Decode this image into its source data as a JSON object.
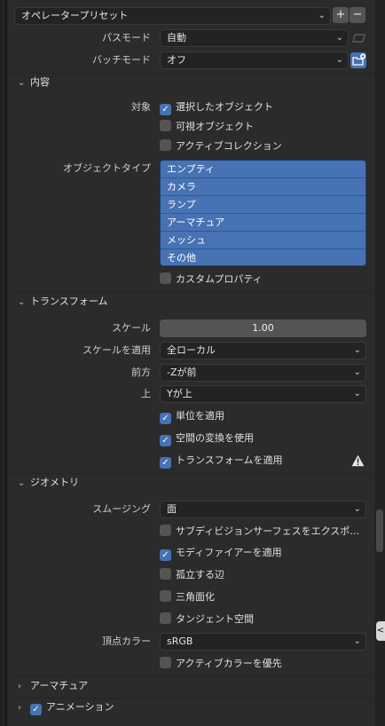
{
  "preset": {
    "label": "オペレータープリセット",
    "add": "+",
    "remove": "−"
  },
  "path_mode": {
    "label": "パスモード",
    "value": "自動"
  },
  "batch_mode": {
    "label": "バッチモード",
    "value": "オフ"
  },
  "include": {
    "header": "内容",
    "target_label": "対象",
    "selected_objects": "選択したオブジェクト",
    "visible_objects": "可視オブジェクト",
    "active_collection": "アクティブコレクション",
    "object_type_label": "オブジェクトタイプ",
    "object_types": [
      "エンプティ",
      "カメラ",
      "ランプ",
      "アーマチュア",
      "メッシュ",
      "その他"
    ],
    "custom_properties": "カスタムプロパティ"
  },
  "transform": {
    "header": "トランスフォーム",
    "scale_label": "スケール",
    "scale_value": "1.00",
    "apply_scale_label": "スケールを適用",
    "apply_scale_value": "全ローカル",
    "forward_label": "前方",
    "forward_value": "-Zが前",
    "up_label": "上",
    "up_value": "Yが上",
    "apply_unit": "単位を適用",
    "use_space_transform": "空間の変換を使用",
    "apply_transform": "トランスフォームを適用"
  },
  "geometry": {
    "header": "ジオメトリ",
    "smoothing_label": "スムージング",
    "smoothing_value": "面",
    "export_subdivision": "サブディビジョンサーフェスをエクスポ…",
    "apply_modifiers": "モディファイアーを適用",
    "loose_edges": "孤立する辺",
    "triangulate": "三角面化",
    "tangent_space": "タンジェント空間",
    "vertex_color_label": "頂点カラー",
    "vertex_color_value": "sRGB",
    "prioritize_active_color": "アクティブカラーを優先"
  },
  "armature": {
    "header": "アーマチュア"
  },
  "animation": {
    "header": "アニメーション"
  },
  "side_tab": "<"
}
